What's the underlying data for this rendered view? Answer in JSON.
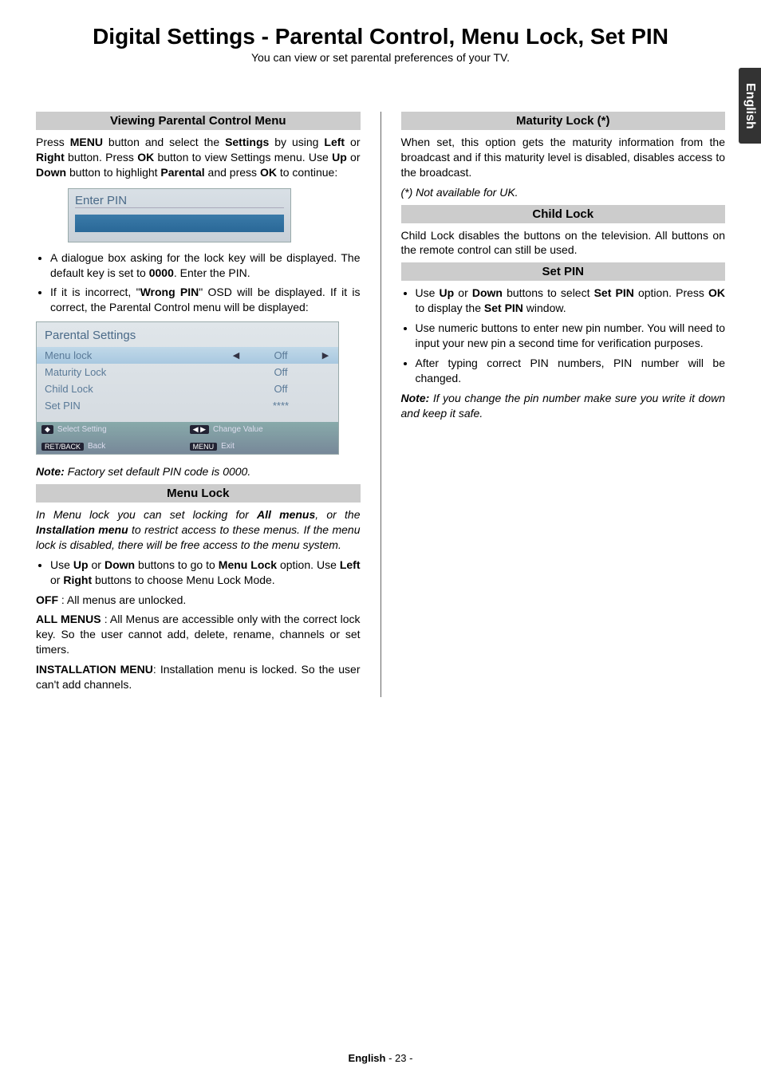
{
  "lang_tab": "English",
  "title": "Digital Settings - Parental Control, Menu Lock, Set PIN",
  "subtitle": "You can view or set parental preferences of your TV.",
  "left": {
    "sect1": "Viewing Parental Control Menu",
    "p1_pre": "Press ",
    "p1_menu": "MENU",
    "p1_mid1": " button and select the ",
    "p1_settings": "Settings",
    "p1_mid2": " by using ",
    "p1_left": "Left",
    "p1_or1": " or ",
    "p1_right": "Right",
    "p1_mid3": " button. Press ",
    "p1_ok": "OK",
    "p1_mid4": " button to view Settings menu. Use ",
    "p1_up": "Up",
    "p1_or2": " or ",
    "p1_down": "Down",
    "p1_mid5": " button to highlight ",
    "p1_parental": "Parental",
    "p1_mid6": " and press ",
    "p1_ok2": "OK",
    "p1_end": " to continue:",
    "osd_enter_pin": "Enter PIN",
    "bullet1_pre": "A dialogue box asking for the lock key will be displayed. The default key is set to ",
    "bullet1_code": "0000",
    "bullet1_end": ". Enter the PIN.",
    "bullet2_pre": "If it is incorrect, \"",
    "bullet2_wrong": "Wrong PIN",
    "bullet2_end": "\" OSD will be displayed. If it is correct, the Parental Control menu will be displayed:",
    "osd2_title": "Parental Settings",
    "osd2_rows": [
      {
        "label": "Menu lock",
        "val": "Off"
      },
      {
        "label": "Maturity Lock",
        "val": "Off"
      },
      {
        "label": "Child Lock",
        "val": "Off"
      },
      {
        "label": "Set PIN",
        "val": "****"
      }
    ],
    "osd2_footer": {
      "select": "Select Setting",
      "change": "Change Value",
      "back": "Back",
      "exit": "Exit"
    },
    "note2_bold": "Note:",
    "note2_text": " Factory set default PIN code is 0000.",
    "sect2": "Menu Lock",
    "ml_intro_pre": "In Menu lock you can set locking for ",
    "ml_intro_all": "All menus",
    "ml_intro_mid": ", or the ",
    "ml_intro_inst": "Installation menu",
    "ml_intro_end": " to restrict access to these menus. If the menu lock is disabled, there will be free access to the menu system.",
    "ml_b1_pre": "Use ",
    "ml_b1_up": "Up",
    "ml_b1_or1": " or ",
    "ml_b1_down": "Down",
    "ml_b1_mid": " buttons to go to ",
    "ml_b1_ml": "Menu Lock",
    "ml_b1_mid2": " option. Use ",
    "ml_b1_left": "Left",
    "ml_b1_or2": " or ",
    "ml_b1_right": "Right",
    "ml_b1_end": " buttons to choose Menu Lock Mode.",
    "ml_off_b": "OFF",
    "ml_off_t": " : All menus are unlocked.",
    "ml_all_b": "ALL MENUS",
    "ml_all_t": " : All Menus are accessible only with the correct lock key. So the user cannot add, delete, rename, channels or set timers.",
    "ml_inst_b": "INSTALLATION MENU",
    "ml_inst_t": ": Installation menu is locked. So the user can't add channels."
  },
  "right": {
    "sect1": "Maturity Lock (*)",
    "mat_p1": "When set, this option gets the maturity information from the broadcast and if this maturity level is disabled, disables access to the broadcast.",
    "mat_note": "(*) Not available for UK.",
    "sect2": "Child Lock",
    "child_p1": "Child Lock disables the buttons on the television. All buttons on the remote control can still be used.",
    "sect3": "Set PIN",
    "sp_b1_pre": "Use ",
    "sp_b1_up": "Up",
    "sp_b1_or": " or ",
    "sp_b1_down": "Down",
    "sp_b1_mid": " buttons to select ",
    "sp_b1_setpin": "Set PIN",
    "sp_b1_mid2": " option. Press ",
    "sp_b1_ok": "OK",
    "sp_b1_mid3": " to display the ",
    "sp_b1_setpin2": "Set PIN",
    "sp_b1_end": " window.",
    "sp_b2": "Use numeric buttons to enter new pin number. You will need to input your new pin a second time for verification purposes.",
    "sp_b3": "After typing correct PIN numbers, PIN number will be changed.",
    "sp_note_b": "Note:",
    "sp_note_t": " If you change the pin number make sure you write it down and keep it safe."
  },
  "footer": {
    "lang": "English",
    "sep": "  - ",
    "page": "23",
    "end": " -"
  }
}
